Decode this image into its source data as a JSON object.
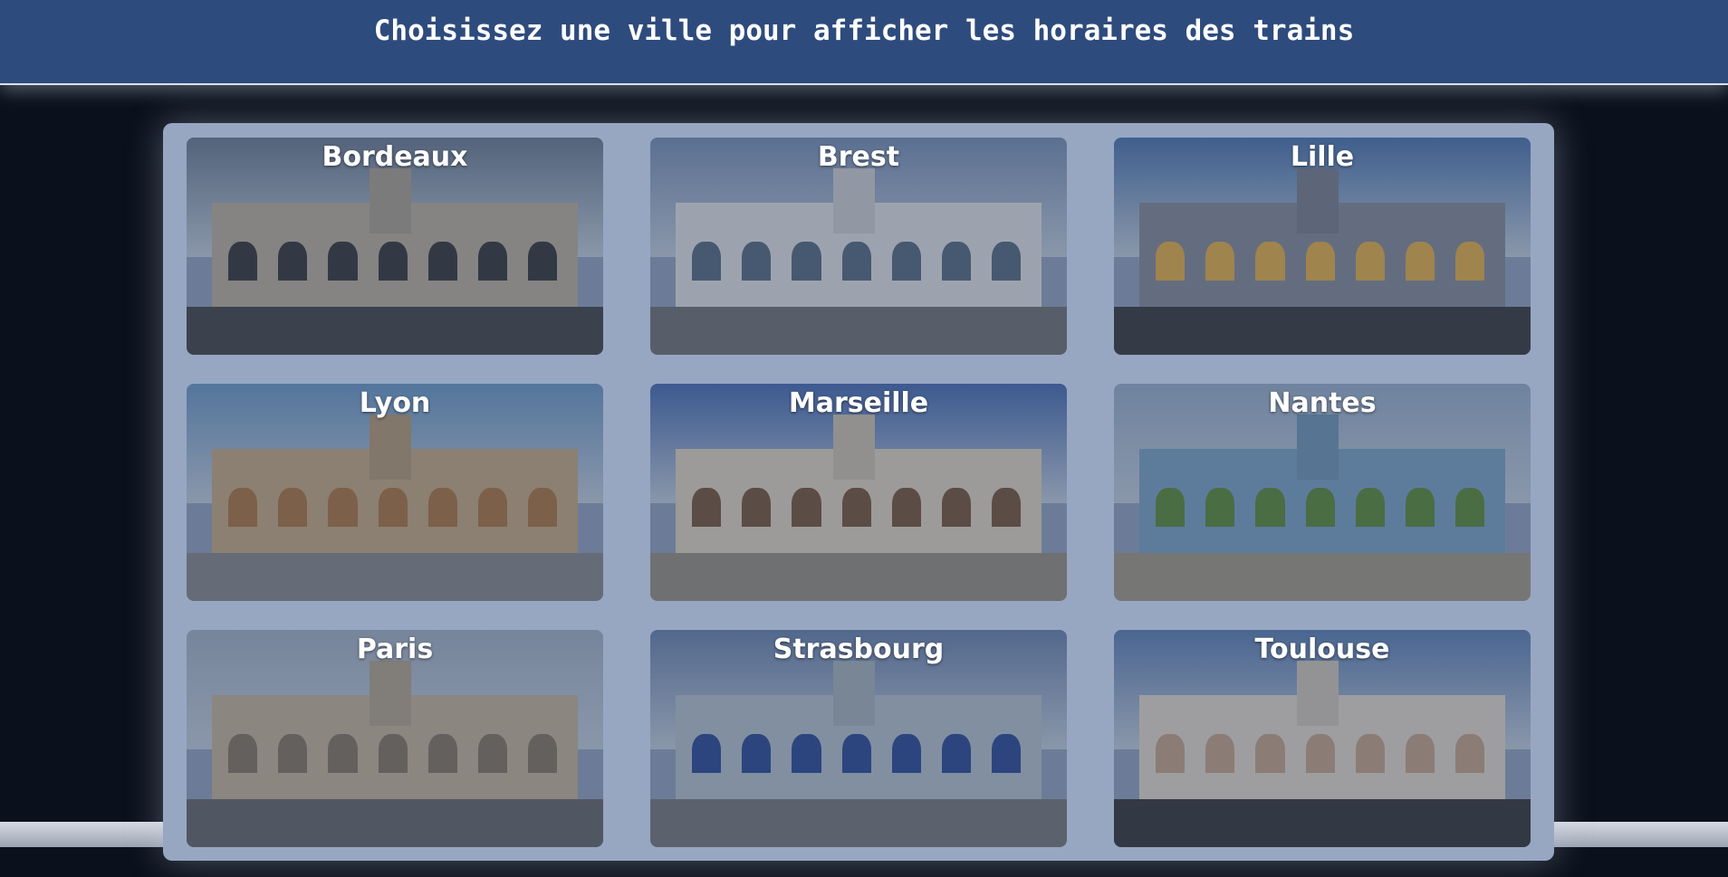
{
  "header": {
    "title": "Choisissez une ville pour afficher les horaires des trains"
  },
  "cities": [
    {
      "name": "Bordeaux",
      "sky": "#6f7f93",
      "building": "#bfb3a0",
      "ground": "#4a4a4a",
      "accent": "#3b3b3b"
    },
    {
      "name": "Brest",
      "sky": "#7b93b8",
      "building": "#e6e6e6",
      "ground": "#777777",
      "accent": "#5a6e82"
    },
    {
      "name": "Lille",
      "sky": "#4f78b0",
      "building": "#8a8f9c",
      "ground": "#3e3e3e",
      "accent": "#e8b34a"
    },
    {
      "name": "Lyon",
      "sky": "#6f9cc9",
      "building": "#c9ad84",
      "ground": "#8d8d8d",
      "accent": "#b07a45"
    },
    {
      "name": "Marseille",
      "sky": "#4a6fb5",
      "building": "#e4d8c4",
      "ground": "#9b9384",
      "accent": "#7d5a3e"
    },
    {
      "name": "Nantes",
      "sky": "#9bb2cd",
      "building": "#7fa7c8",
      "ground": "#a79e8a",
      "accent": "#5f8e3a"
    },
    {
      "name": "Paris",
      "sky": "#a8b5c8",
      "building": "#c9b79a",
      "ground": "#6b6b6b",
      "accent": "#8a7a64"
    },
    {
      "name": "Strasbourg",
      "sky": "#6d86b0",
      "building": "#b9c6cf",
      "ground": "#7d7d7d",
      "accent": "#2f4e9a"
    },
    {
      "name": "Toulouse",
      "sky": "#6083b6",
      "building": "#e7ddd0",
      "ground": "#3a3a3a",
      "accent": "#c8a98c"
    }
  ]
}
